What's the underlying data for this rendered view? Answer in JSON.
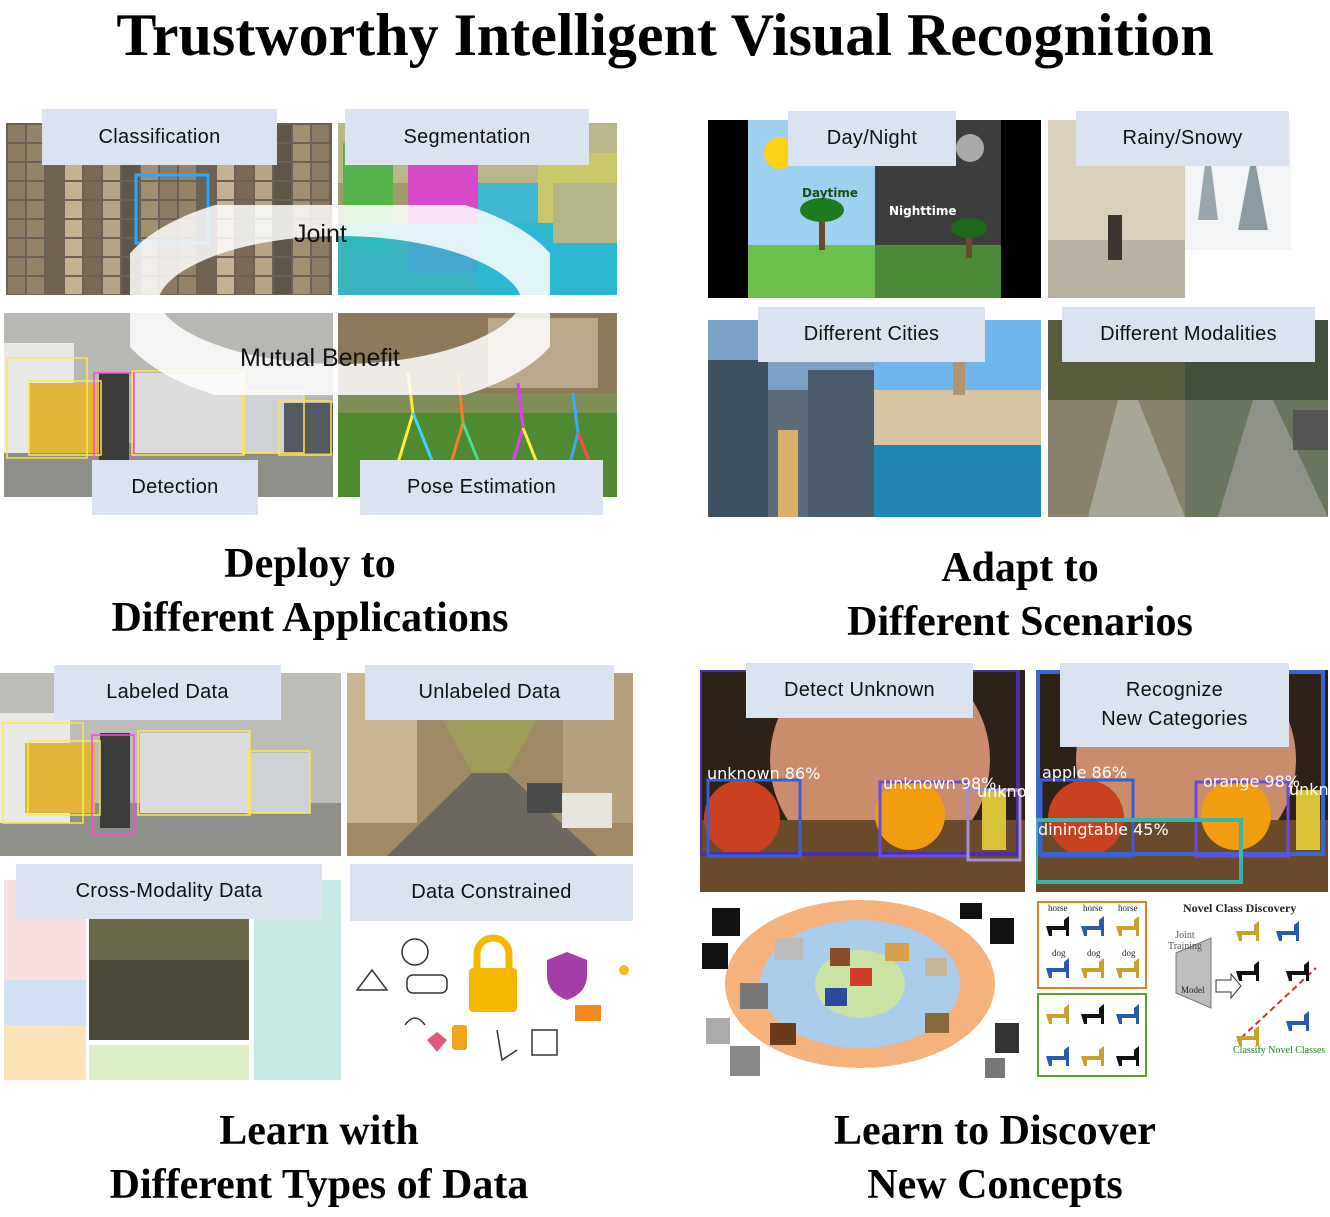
{
  "title": "Trustworthy Intelligent Visual Recognition",
  "quadrants": {
    "applications": {
      "caption": [
        "Deploy to",
        "Different Applications"
      ],
      "labels": {
        "classification": "Classification",
        "segmentation": "Segmentation",
        "detection": "Detection",
        "pose": "Pose Estimation"
      },
      "overlay": {
        "joint": "Joint",
        "mutual": "Mutual Benefit"
      }
    },
    "scenarios": {
      "caption": [
        "Adapt to",
        "Different Scenarios"
      ],
      "labels": {
        "day_night": "Day/Night",
        "rainy_snowy": "Rainy/Snowy",
        "cities": "Different Cities",
        "modalities": "Different Modalities"
      },
      "scene_text": {
        "daytime": "Daytime",
        "nighttime": "Nighttime"
      }
    },
    "data_types": {
      "caption": [
        "Learn with",
        "Different Types of Data"
      ],
      "labels": {
        "labeled": "Labeled Data",
        "unlabeled": "Unlabeled Data",
        "cross_modality": "Cross-Modality Data",
        "constrained": "Data Constrained"
      }
    },
    "discover": {
      "caption": [
        "Learn to Discover",
        "New Concepts"
      ],
      "labels": {
        "detect_unknown": "Detect Unknown",
        "recognize_new": [
          "Recognize",
          "New Categories"
        ]
      },
      "detections_unknown": [
        "unknown 86%",
        "unknown 98%",
        "unkno"
      ],
      "detections_known": [
        "apple 86%",
        "orange 98%",
        "diningtable 45%",
        "unkn"
      ],
      "ncd": {
        "title": "Novel Class Discovery",
        "joint_training": "Joint Training",
        "model": "Model",
        "classify": "Classify Novel Classes",
        "classes": [
          "horse",
          "horse",
          "horse",
          "dog",
          "dog",
          "dog"
        ]
      }
    }
  },
  "colors": {
    "label_bg": "#dbe3f1",
    "accent_orange": "#f6b27c",
    "accent_blue": "#a9cdea",
    "accent_green": "#c9e3a5"
  }
}
